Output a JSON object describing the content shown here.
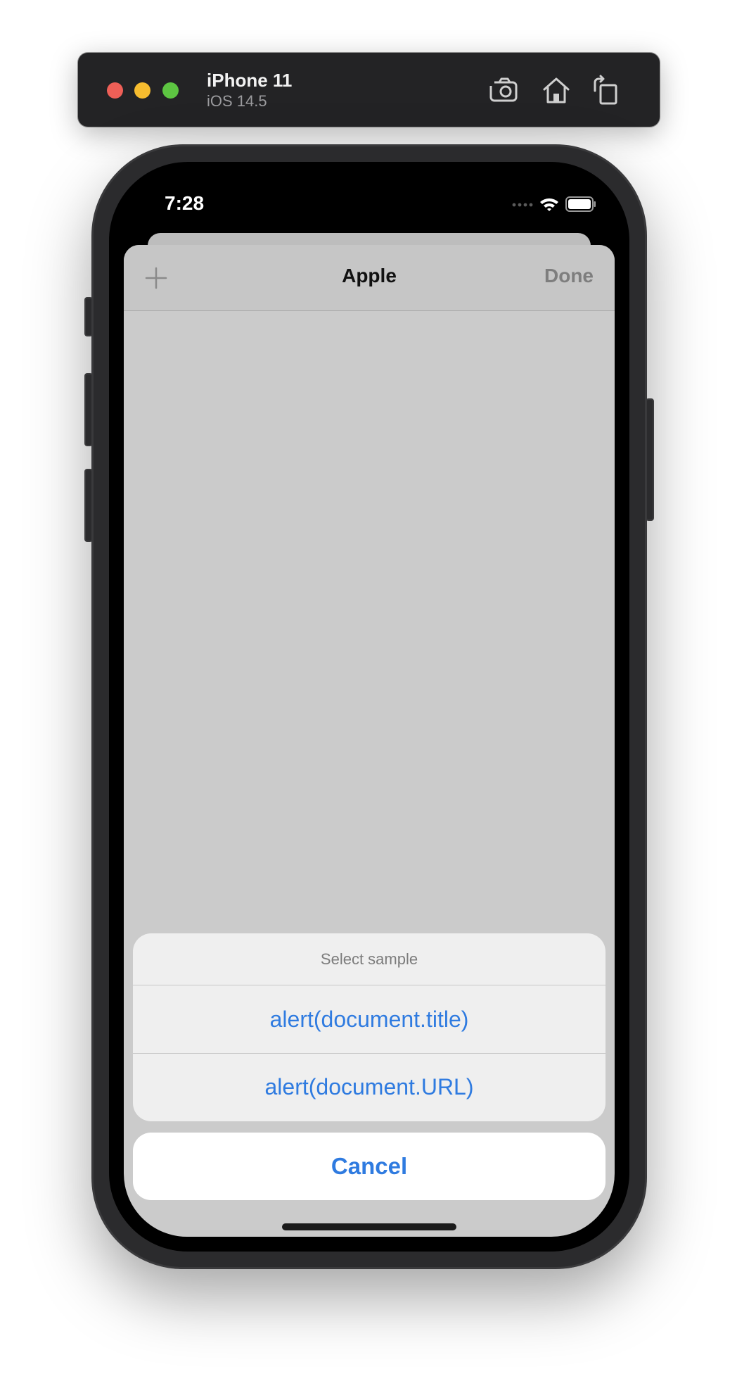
{
  "simulator": {
    "device_name": "iPhone 11",
    "os_version": "iOS 14.5",
    "buttons": [
      {
        "icon": "screenshot-camera-icon"
      },
      {
        "icon": "home-icon"
      },
      {
        "icon": "rotate-icon"
      }
    ]
  },
  "status_bar": {
    "time": "7:28",
    "icons": [
      "cellular-icon",
      "wifi-icon",
      "battery-icon"
    ]
  },
  "navbar": {
    "title": "Apple",
    "done_label": "Done",
    "add_icon": "plus-icon"
  },
  "action_sheet": {
    "title": "Select sample",
    "options": [
      {
        "label": "alert(document.title)"
      },
      {
        "label": "alert(document.URL)"
      }
    ],
    "cancel_label": "Cancel"
  },
  "colors": {
    "accent": "#2f7be0",
    "sheet_background": "#cbcbcb",
    "toolbar_background": "#232325"
  }
}
